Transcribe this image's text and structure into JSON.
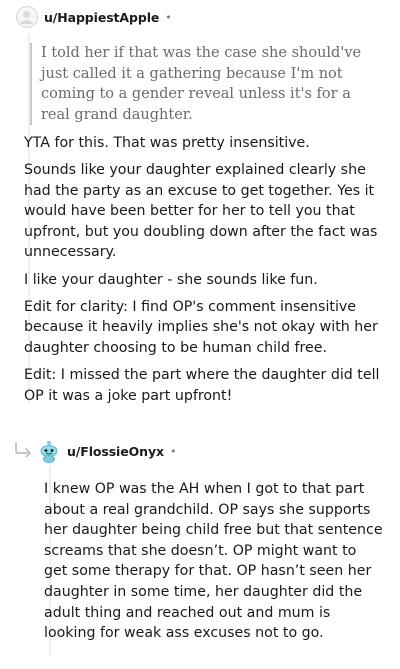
{
  "comment1": {
    "avatar_icon": "user-avatar-icon",
    "username": "u/HappiestApple",
    "separator": "•",
    "quote": "I told her if that was the case she should've just called it a gathering because I'm not coming to a gender reveal unless it's for a real grand daughter.",
    "paragraphs": [
      "YTA for this. That was pretty insensitive.",
      "Sounds like your daughter explained clearly she had the party as an excuse to get together. Yes it would have been better for her to tell you that upfront, but you doubling down after the fact was unnecessary.",
      "I like your daughter - she sounds like fun.",
      "Edit for clarity: I find OP's comment insensitive because it heavily implies she's not okay with her daughter choosing to be human child free.",
      "Edit: I missed the part where the daughter did tell OP it was a joke part upfront!"
    ]
  },
  "comment2": {
    "reply_icon": "reply-arrow-icon",
    "avatar_icon": "snoo-avatar-icon",
    "username": "u/FlossieOnyx",
    "separator": "•",
    "text": "I knew OP was the AH when I got to that part about a real grandchild. OP says she supports her daughter being child free but that sentence screams that she doesn’t. OP might want to get some therapy for that. OP hasn’t seen her daughter in some time, her daughter did the adult thing and reached out and mum is looking for weak ass excuses not to go."
  }
}
